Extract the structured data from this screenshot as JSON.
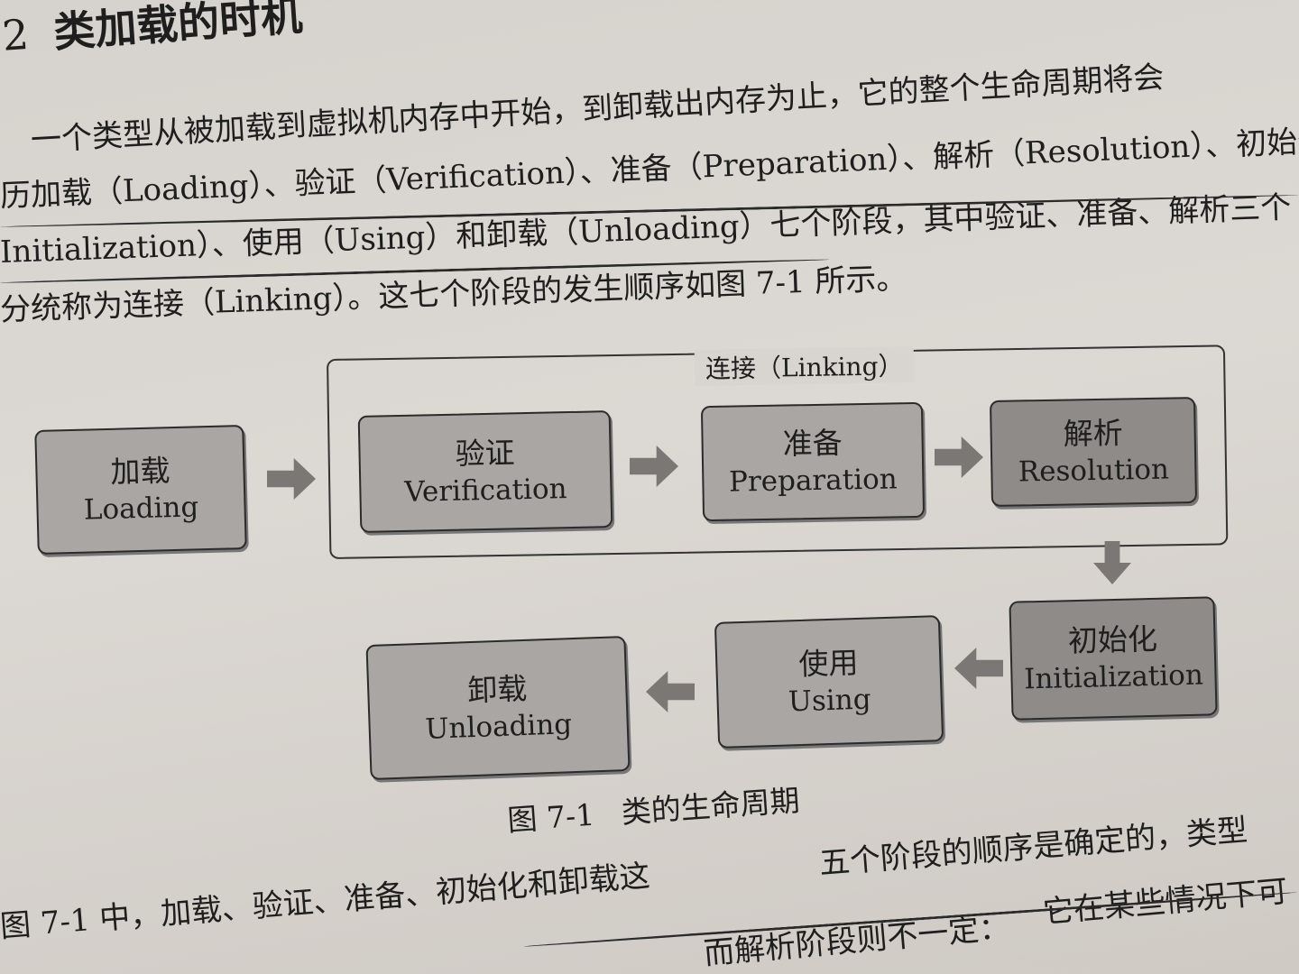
{
  "section": {
    "number": "2",
    "title": "类加载的时机"
  },
  "paragraph1": {
    "lines": [
      "一个类型从被加载到虚拟机内存中开始，到卸载出内存为止，它的整个生命周期将会",
      "历加载（Loading）、验证（Verification）、准备（Preparation）、解析（Resolution）、初始化",
      "Initialization）、使用（Using）和卸载（Unloading）七个阶段，其中验证、准备、解析三个",
      "分统称为连接（Linking）。这七个阶段的发生顺序如图 7-1 所示。"
    ]
  },
  "diagram": {
    "linking_label": "连接（Linking）",
    "stages": {
      "loading": {
        "cn": "加载",
        "en": "Loading"
      },
      "verification": {
        "cn": "验证",
        "en": "Verification"
      },
      "preparation": {
        "cn": "准备",
        "en": "Preparation"
      },
      "resolution": {
        "cn": "解析",
        "en": "Resolution"
      },
      "initialization": {
        "cn": "初始化",
        "en": "Initialization"
      },
      "using": {
        "cn": "使用",
        "en": "Using"
      },
      "unloading": {
        "cn": "卸载",
        "en": "Unloading"
      }
    },
    "caption_number": "图 7-1",
    "caption_text": "类的生命周期"
  },
  "paragraph2": {
    "lines": [
      "五个阶段的顺序是确定的，类型",
      "图 7-1 中，加载、验证、准备、初始化和卸载这",
      "它在某些情况下可",
      "而解析阶段则不一定："
    ]
  },
  "colors": {
    "paper": "#d8d4cf",
    "box_light": "#a9a6a3",
    "box_dark": "#8e8b88",
    "arrow": "#7a7775"
  }
}
